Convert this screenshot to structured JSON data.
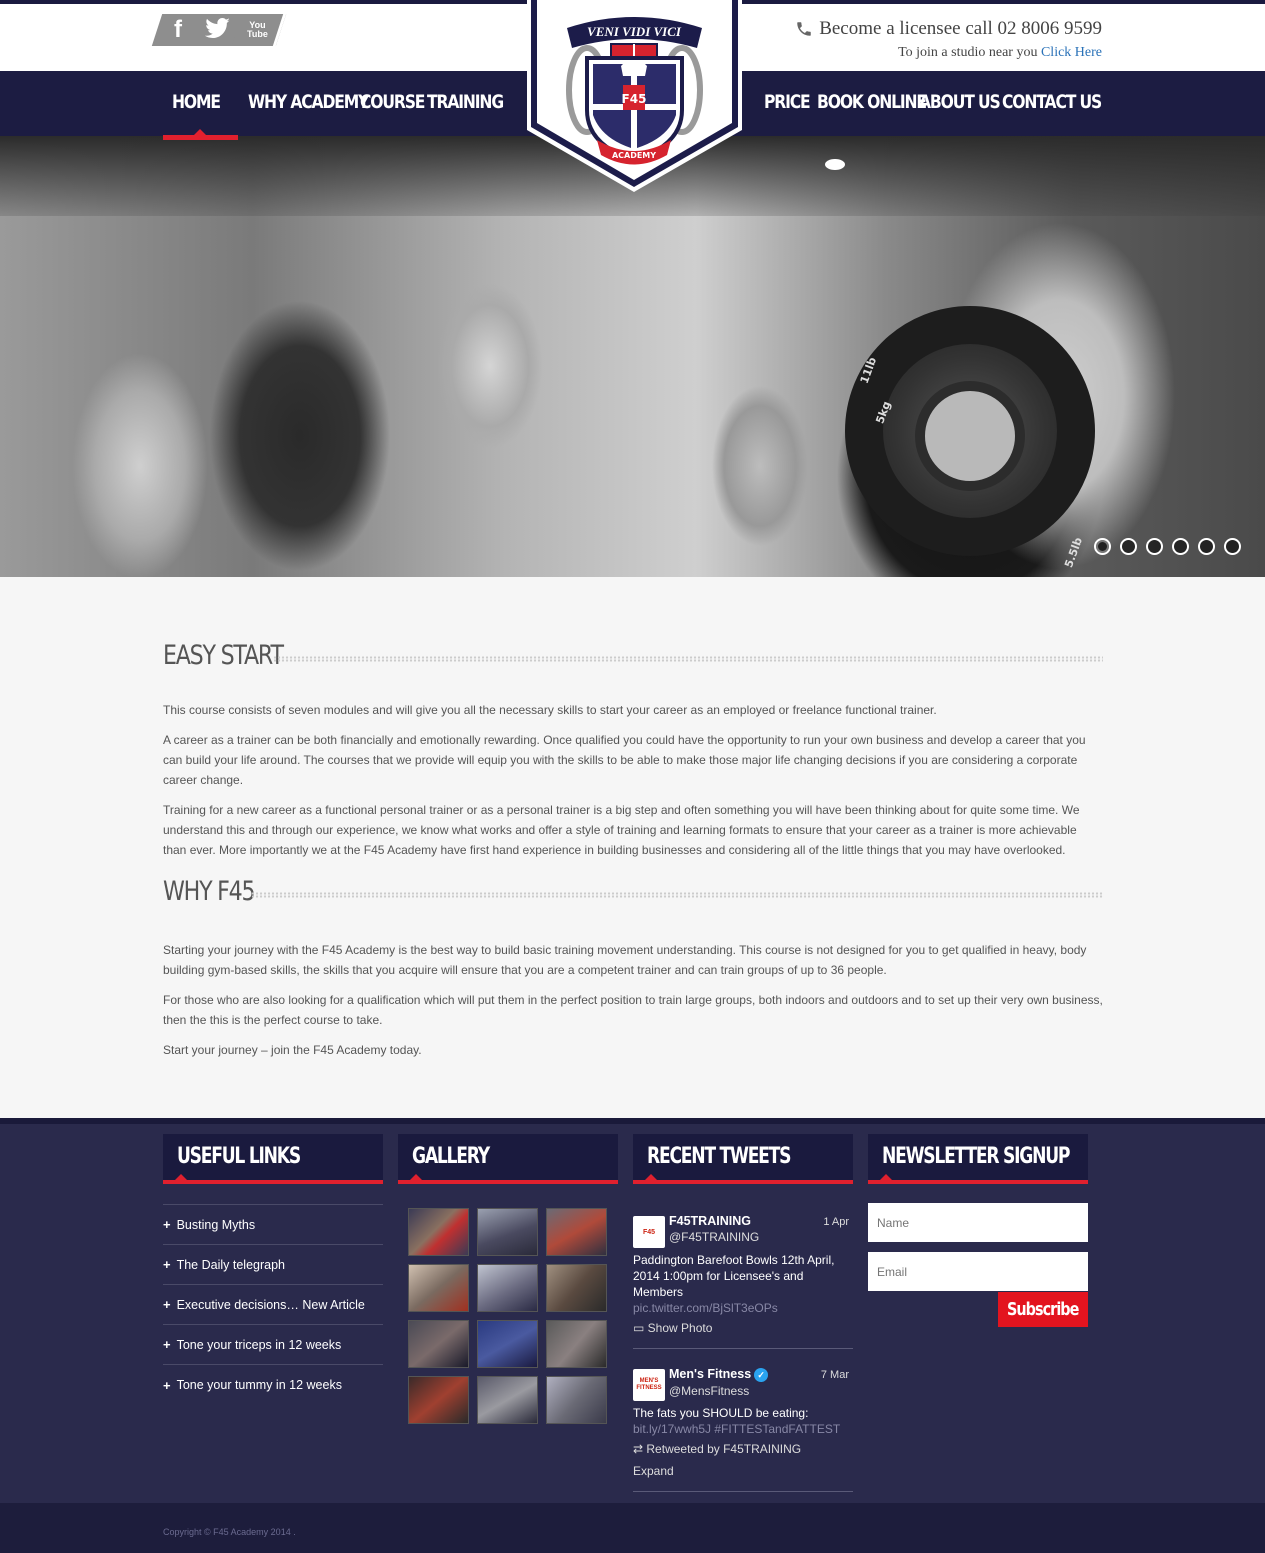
{
  "social": {
    "facebook": "f",
    "twitter": "🐦",
    "youtube_line1": "You",
    "youtube_line2": "Tube"
  },
  "contact": {
    "phone_line": "Become a licensee call 02 8006 9599",
    "studio_text": "To join a studio near you",
    "studio_link": "Click Here"
  },
  "logo": {
    "motto": "VENI VIDI VICI",
    "brand": "F45",
    "ribbon": "ACADEMY"
  },
  "nav": {
    "left": [
      "HOME",
      "WHY ACADEMY",
      "COURSE",
      "TRAINING"
    ],
    "right": [
      "PRICE",
      "BOOK ONLINE",
      "ABOUT US",
      "CONTACT US"
    ],
    "active": "HOME"
  },
  "hero": {
    "slide_count": 6,
    "active_slide": 1,
    "plate_label_1": "11lb",
    "plate_label_2": "5kg",
    "plate_label_3": "5.5lb"
  },
  "sections": [
    {
      "title": "EASY START",
      "paragraphs": [
        "This course consists of seven modules and will give you all the necessary skills to start your career as an employed or freelance functional trainer.",
        "A career as a trainer can be both financially and emotionally rewarding. Once qualified you could have the opportunity to run your own business and develop a career that you can build your life around. The courses that we provide will equip you with the skills to be able to make those major life changing decisions if you are considering a corporate career change.",
        "Training for a new career as a functional personal trainer or as a personal trainer is a big step and often something you will have been thinking about for quite some time. We understand this and through our experience, we know what works and offer a style of training and learning formats to ensure that your career as a trainer is more achievable than ever. More importantly we at the F45 Academy have first hand experience in building businesses and considering all of the little things that you may have overlooked."
      ]
    },
    {
      "title": "WHY F45",
      "paragraphs": [
        "Starting your journey with the F45 Academy is the best way to build basic training movement understanding. This course is not designed for you to get qualified in heavy, body building gym-based skills, the skills that you acquire will ensure that you are a competent trainer and can train groups of up to 36 people.",
        "For those who are also looking for a qualification which will put them in the perfect position to train large groups, both indoors and outdoors and to set up their very own business, then the this is the perfect course to take.",
        "Start your journey – join the F45 Academy today."
      ]
    }
  ],
  "footer": {
    "useful_links": {
      "title": "USEFUL LINKS",
      "items": [
        "Busting Myths",
        "The Daily telegraph",
        "Executive decisions… New Article",
        "Tone your triceps in 12 weeks",
        "Tone your tummy in 12 weeks"
      ]
    },
    "gallery": {
      "title": "GALLERY",
      "thumb_count": 12
    },
    "tweets": {
      "title": "RECENT TWEETS",
      "items": [
        {
          "name": "F45TRAINING",
          "handle": "@F45TRAINING",
          "date": "1 Apr",
          "avatar_text": "F45",
          "text": "Paddington Barefoot Bowls 12th April, 2014 1:00pm for Licensee's and Members",
          "link": "pic.twitter.com/BjSlT3eOPs",
          "meta1": "Show Photo",
          "meta2": ""
        },
        {
          "name": "Men's Fitness",
          "handle": "@MensFitness",
          "date": "7 Mar",
          "avatar_text": "MEN'S FITNESS",
          "text": "The fats you SHOULD be eating:",
          "link": "bit.ly/17wwh5J #FITTESTandFATTEST",
          "meta1": "Retweeted by F45TRAINING",
          "meta2": "Expand"
        }
      ]
    },
    "newsletter": {
      "title": "NEWSLETTER SIGNUP",
      "name_placeholder": "Name",
      "email_placeholder": "Email",
      "button": "Subscribe"
    },
    "copyright": "Copyright © F45 Academy 2014 ."
  },
  "colors": {
    "navy": "#1c1c42",
    "accent_red": "#e0202e",
    "link_blue": "#2a72b8",
    "footer_bg": "#2a2a4c"
  }
}
